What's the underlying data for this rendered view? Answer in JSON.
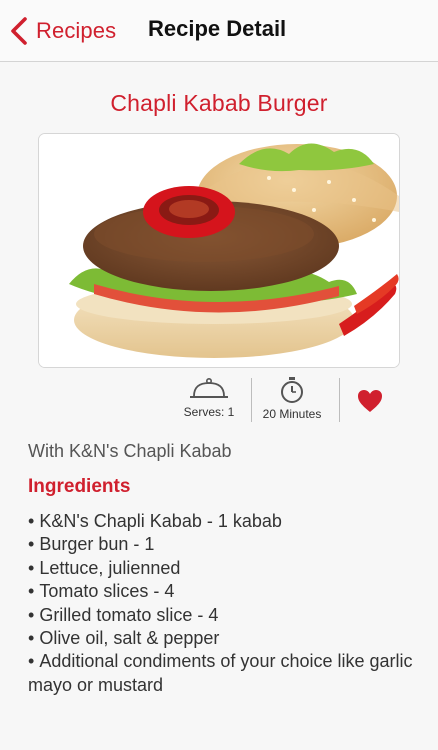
{
  "navbar": {
    "back_label": "Recipes",
    "title": "Recipe Detail"
  },
  "recipe": {
    "title": "Chapli Kabab Burger",
    "serves": "Serves: 1",
    "time": "20 Minutes",
    "subtitle": "With K&N's Chapli Kabab",
    "ingredients_heading": "Ingredients",
    "ingredients": [
      "K&N's Chapli Kabab - 1 kabab",
      "Burger bun - 1",
      "Lettuce, julienned",
      "Tomato slices - 4",
      "Grilled tomato slice - 4",
      "Olive oil, salt & pepper",
      "Additional condiments of your choice like garlic mayo or mustard"
    ]
  },
  "icons": {
    "back": "chevron-left-icon",
    "serves": "cloche-icon",
    "time": "stopwatch-icon",
    "favorite": "heart-icon"
  },
  "colors": {
    "accent": "#d0202e",
    "background": "#f7f7f7"
  }
}
